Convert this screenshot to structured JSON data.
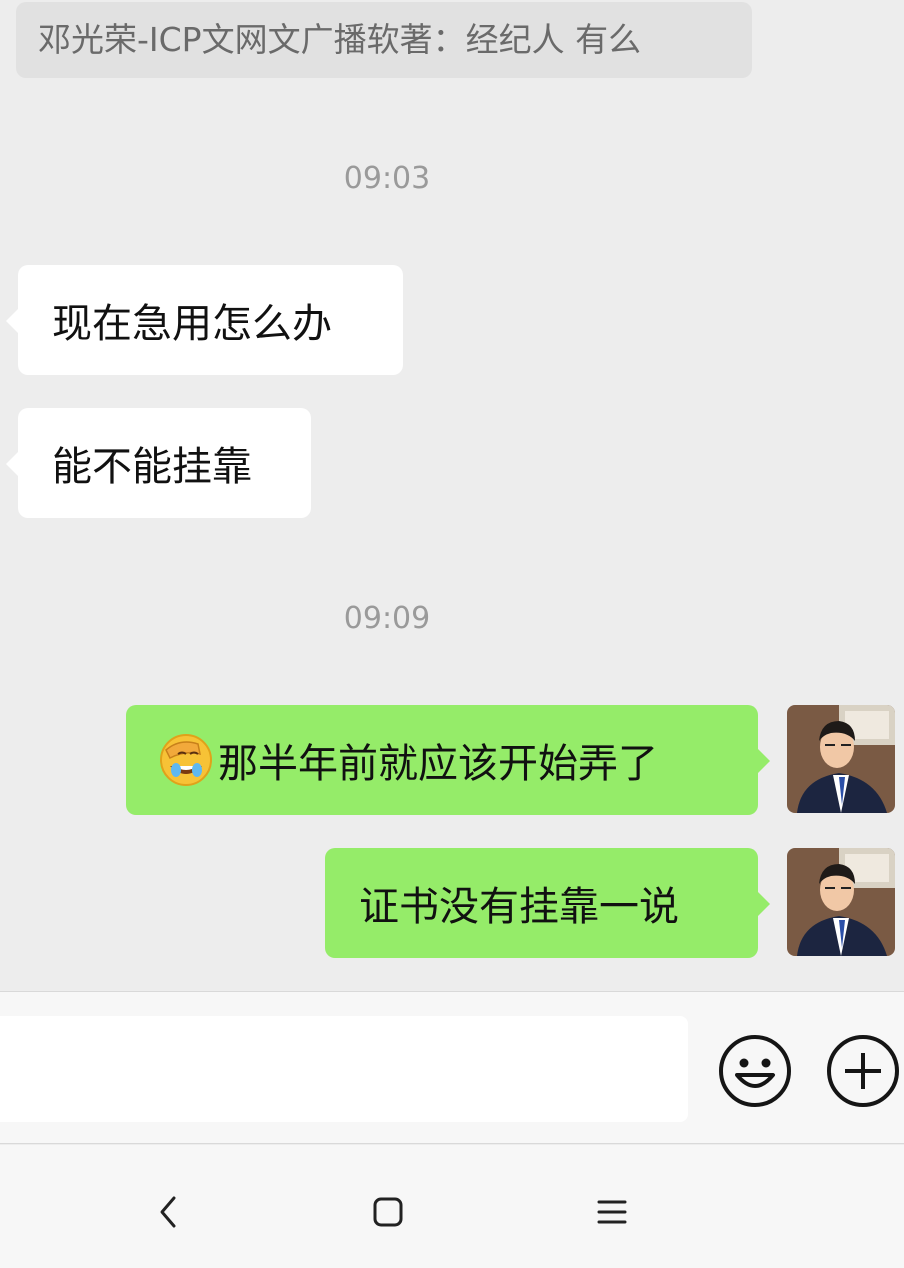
{
  "quote": {
    "text": "邓光荣-ICP文网文广播软著：经纪人 有么"
  },
  "timestamps": [
    "09:03",
    "09:09"
  ],
  "incoming": [
    {
      "text": "现在急用怎么办"
    },
    {
      "text": "能不能挂靠"
    }
  ],
  "outgoing": [
    {
      "emoji": "facepalm-laughing-emoji",
      "text": "那半年前就应该开始弄了"
    },
    {
      "text": "证书没有挂靠一说"
    }
  ],
  "input": {
    "value": "",
    "placeholder": ""
  },
  "colors": {
    "background": "#ededed",
    "incoming_bubble": "#ffffff",
    "outgoing_bubble": "#95ec69",
    "quote_background": "#e1e1e1"
  },
  "icons": {
    "emoji_button": "smiley-icon",
    "more_button": "plus-circle-icon",
    "nav_back": "chevron-left-icon",
    "nav_home": "square-icon",
    "nav_menu": "menu-lines-icon"
  }
}
